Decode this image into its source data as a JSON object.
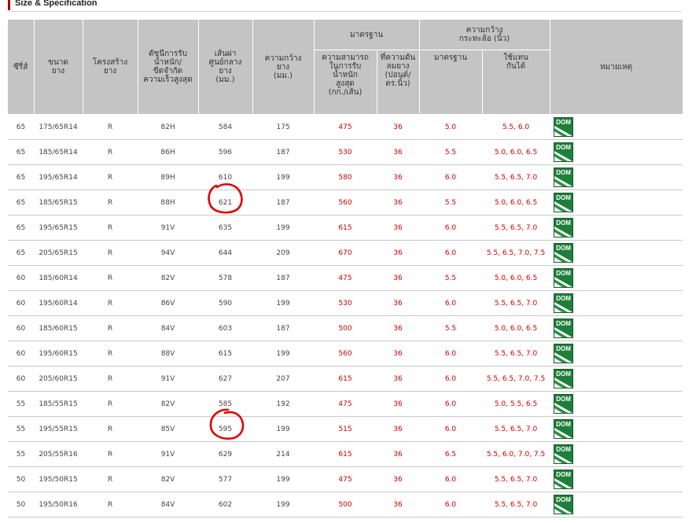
{
  "section": {
    "title": "Size & Specification"
  },
  "headers": {
    "series": "ซีรี่ส์",
    "size": "ขนาด\nยาง",
    "structure": "โครงสร้าง\nยาง",
    "load_speed": "ดัชนีการรับ\nน้ำหนัก/\nขีดจำกัด\nความเร็วสูงสุด",
    "diameter": "เส้นผ่า\nศูนย์กลาง\nยาง\n(มม.)",
    "width": "ความกว้าง\nยาง\n(มม.)",
    "standard_group": "มาตรฐาน",
    "max_load": "ความสามารถ\nในการรับ\nน้ำหนัก\nสูงสุด\n(กก./เส้น)",
    "pressure": "ที่ความดัน\nลมยาง\n(ปอนด์/\nตร.นิ้ว)",
    "rim_group": "ความกว้าง\nกระทะล้อ (นิ้ว)",
    "rim_standard": "มาตรฐาน",
    "rim_alt": "ใช้แทน\nกันได้",
    "remark": "หมายเหตุ"
  },
  "badge": {
    "label": "DOM",
    "color": "#1e7f3a"
  },
  "rows": [
    {
      "series": "65",
      "size": "175/65R14",
      "structure": "R",
      "load_speed": "82H",
      "diameter": "584",
      "width": "175",
      "max_load": "475",
      "pressure": "36",
      "rim_standard": "5.0",
      "rim_alt": "5.5, 6.0"
    },
    {
      "series": "65",
      "size": "185/65R14",
      "structure": "R",
      "load_speed": "86H",
      "diameter": "596",
      "width": "187",
      "max_load": "530",
      "pressure": "36",
      "rim_standard": "5.5",
      "rim_alt": "5.0, 6.0, 6.5"
    },
    {
      "series": "65",
      "size": "195/65R14",
      "structure": "R",
      "load_speed": "89H",
      "diameter": "610",
      "width": "199",
      "max_load": "580",
      "pressure": "36",
      "rim_standard": "6.0",
      "rim_alt": "5.5, 6.5, 7.0"
    },
    {
      "series": "65",
      "size": "185/65R15",
      "structure": "R",
      "load_speed": "88H",
      "diameter": "621",
      "width": "187",
      "max_load": "560",
      "pressure": "36",
      "rim_standard": "5.5",
      "rim_alt": "5.0, 6.0, 6.5"
    },
    {
      "series": "65",
      "size": "195/65R15",
      "structure": "R",
      "load_speed": "91V",
      "diameter": "635",
      "width": "199",
      "max_load": "615",
      "pressure": "36",
      "rim_standard": "6.0",
      "rim_alt": "5.5, 6.5, 7.0"
    },
    {
      "series": "65",
      "size": "205/65R15",
      "structure": "R",
      "load_speed": "94V",
      "diameter": "644",
      "width": "209",
      "max_load": "670",
      "pressure": "36",
      "rim_standard": "6.0",
      "rim_alt": "5.5, 6.5, 7.0, 7.5"
    },
    {
      "series": "60",
      "size": "185/60R14",
      "structure": "R",
      "load_speed": "82V",
      "diameter": "578",
      "width": "187",
      "max_load": "475",
      "pressure": "36",
      "rim_standard": "5.5",
      "rim_alt": "5.0, 6.0, 6.5"
    },
    {
      "series": "60",
      "size": "195/60R14",
      "structure": "R",
      "load_speed": "86V",
      "diameter": "590",
      "width": "199",
      "max_load": "530",
      "pressure": "36",
      "rim_standard": "6.0",
      "rim_alt": "5.5, 6.5, 7.0"
    },
    {
      "series": "60",
      "size": "185/60R15",
      "structure": "R",
      "load_speed": "84V",
      "diameter": "603",
      "width": "187",
      "max_load": "500",
      "pressure": "36",
      "rim_standard": "5.5",
      "rim_alt": "5.0, 6.0, 6.5"
    },
    {
      "series": "60",
      "size": "195/60R15",
      "structure": "R",
      "load_speed": "88V",
      "diameter": "615",
      "width": "199",
      "max_load": "560",
      "pressure": "36",
      "rim_standard": "6.0",
      "rim_alt": "5.5, 6.5, 7.0"
    },
    {
      "series": "60",
      "size": "205/60R15",
      "structure": "R",
      "load_speed": "91V",
      "diameter": "627",
      "width": "207",
      "max_load": "615",
      "pressure": "36",
      "rim_standard": "6.0",
      "rim_alt": "5.5, 6.5, 7.0, 7.5"
    },
    {
      "series": "55",
      "size": "185/55R15",
      "structure": "R",
      "load_speed": "82V",
      "diameter": "585",
      "width": "192",
      "max_load": "475",
      "pressure": "36",
      "rim_standard": "6.0",
      "rim_alt": "5.0, 5.5, 6.5"
    },
    {
      "series": "55",
      "size": "195/55R15",
      "structure": "R",
      "load_speed": "85V",
      "diameter": "595",
      "width": "199",
      "max_load": "515",
      "pressure": "36",
      "rim_standard": "6.0",
      "rim_alt": "5.5, 6.5, 7.0"
    },
    {
      "series": "55",
      "size": "205/55R16",
      "structure": "R",
      "load_speed": "91V",
      "diameter": "629",
      "width": "214",
      "max_load": "615",
      "pressure": "36",
      "rim_standard": "6.5",
      "rim_alt": "5.5, 6.0, 7.0, 7.5"
    },
    {
      "series": "50",
      "size": "195/50R15",
      "structure": "R",
      "load_speed": "82V",
      "diameter": "577",
      "width": "199",
      "max_load": "475",
      "pressure": "36",
      "rim_standard": "6.0",
      "rim_alt": "5.5, 6.5, 7.0"
    },
    {
      "series": "50",
      "size": "195/50R16",
      "structure": "R",
      "load_speed": "84V",
      "diameter": "602",
      "width": "199",
      "max_load": "500",
      "pressure": "36",
      "rim_standard": "6.0",
      "rim_alt": "5.5, 6.5, 7.0"
    }
  ]
}
